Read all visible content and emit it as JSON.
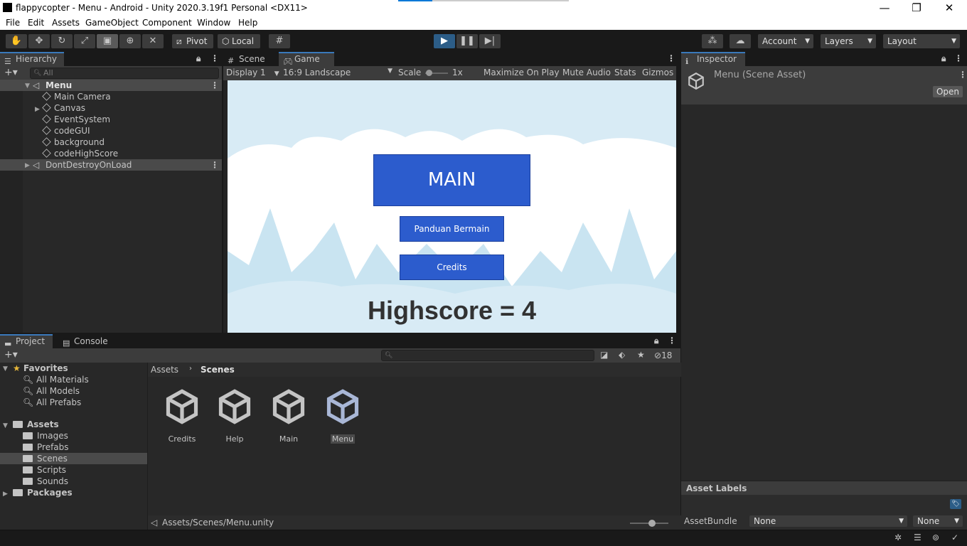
{
  "window": {
    "title": "flappycopter - Menu - Android - Unity 2020.3.19f1 Personal <DX11>",
    "controls": [
      "—",
      "❐",
      "✕"
    ]
  },
  "menu": [
    "File",
    "Edit",
    "Assets",
    "GameObject",
    "Component",
    "Window",
    "Help"
  ],
  "toolbar": {
    "pivot": "Pivot",
    "local": "Local",
    "account": "Account",
    "layers": "Layers",
    "layout": "Layout"
  },
  "hierarchy": {
    "tab": "Hierarchy",
    "search_placeholder": "All",
    "scene": "Menu",
    "items": [
      "Main Camera",
      "Canvas",
      "EventSystem",
      "codeGUI",
      "background",
      "codeHighScore"
    ],
    "dontdestroy": "DontDestroyOnLoad"
  },
  "center_tabs": {
    "scene": "Scene",
    "game": "Game"
  },
  "gamebar": {
    "display": "Display 1",
    "aspect": "16:9 Landscape",
    "scale_label": "Scale",
    "scale_value": "1x",
    "maximize": "Maximize On Play",
    "mute": "Mute Audio",
    "stats": "Stats",
    "gizmos": "Gizmos"
  },
  "game": {
    "main_button": "MAIN",
    "guide_button": "Panduan Bermain",
    "credits_button": "Credits",
    "highscore": "Highscore = 4"
  },
  "inspector": {
    "tab": "Inspector",
    "asset_title": "Menu (Scene Asset)",
    "open": "Open",
    "asset_labels": "Asset Labels",
    "assetbundle_label": "AssetBundle",
    "assetbundle_value": "None",
    "variant_value": "None"
  },
  "project": {
    "tabs": {
      "project": "Project",
      "console": "Console"
    },
    "hidden_count": "18",
    "favorites": "Favorites",
    "fav_items": [
      "All Materials",
      "All Models",
      "All Prefabs"
    ],
    "assets": "Assets",
    "asset_folders": [
      "Images",
      "Prefabs",
      "Scenes",
      "Scripts",
      "Sounds"
    ],
    "packages": "Packages",
    "breadcrumb": {
      "root": "Assets",
      "current": "Scenes"
    },
    "scene_files": [
      "Credits",
      "Help",
      "Main",
      "Menu"
    ],
    "path": "Assets/Scenes/Menu.unity"
  },
  "colors": {
    "accent": "#2c5d87",
    "button_blue": "#2c5ccd",
    "play_active": "#2c5d87"
  }
}
